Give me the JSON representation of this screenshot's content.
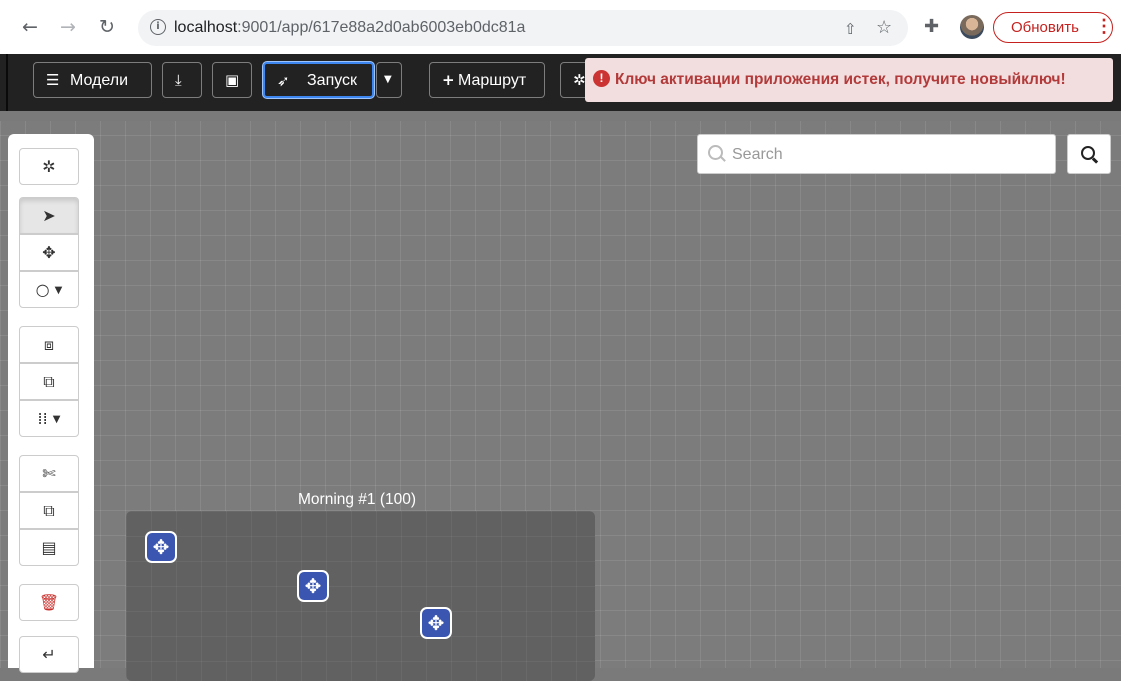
{
  "browser": {
    "back_icon": "arrow-left-icon",
    "forward_icon": "arrow-right-icon",
    "reload_icon": "reload-icon",
    "info_icon": "info-icon",
    "url_host": "localhost",
    "url_rest": ":9001/app/617e88a2d0ab6003eb0dc81a",
    "share_icon": "share-icon",
    "star_icon": "star-icon",
    "extensions_icon": "puzzle-icon",
    "update_label": "Обновить",
    "update_more": "⋮"
  },
  "toolbar": {
    "models_label": "Модели",
    "launch_label": "Запуск",
    "route_label": "Маршрут",
    "alert_text": "Ключ активации приложения истек, получите новыйключ!",
    "alert_icon": "exclamation-circle-icon",
    "alert_color": "#b23a3a"
  },
  "search": {
    "placeholder": "Search"
  },
  "palette": {
    "items": [
      "gear-icon",
      "pointer-icon",
      "move-icon",
      "circle-dropdown-icon",
      "select-box-icon",
      "resize-box-icon",
      "grid-dropdown-icon",
      "scissors-icon",
      "copy-icon",
      "paste-icon",
      "trash-icon",
      "undo-icon"
    ]
  },
  "canvas": {
    "group_label": "Morning #1 (100)",
    "node_color": "#3a56b0"
  }
}
